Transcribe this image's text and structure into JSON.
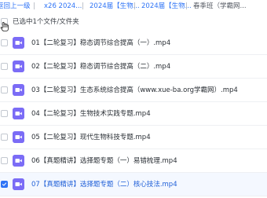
{
  "breadcrumb": {
    "back_label": "返回上一级",
    "separator": "|",
    "crumbs": [
      "x26 2024...",
      "2024届【生物...",
      "2024届【生物..."
    ],
    "current": "春季班（学霸网..."
  },
  "toolbar": {
    "selected_text": "已选中1个文件/文件夹"
  },
  "files": [
    {
      "name": "01【二轮复习】稳态调节综合提高（一）.mp4",
      "selected": false
    },
    {
      "name": "02【二轮复习】稳态调节综合提高（二）.mp4",
      "selected": false
    },
    {
      "name": "03【二轮复习】生态系统综合提高（www.xue-ba.org学霸网）.mp4",
      "selected": false
    },
    {
      "name": "04【二轮复习】生物技术实践专题.mp4",
      "selected": false
    },
    {
      "name": "05【二轮复习】现代生物科技专题.mp4",
      "selected": false
    },
    {
      "name": "06【真题精讲】选择题专题（一）易错梳理.mp4",
      "selected": false
    },
    {
      "name": "07【真题精讲】选择题专题（二）核心技法.mp4",
      "selected": true
    }
  ],
  "colors": {
    "accent": "#2f74f6",
    "video_icon": "#7b6cf6",
    "selected_bg": "#f4f8ff"
  },
  "icons": {
    "video_file": "video-file-icon",
    "cursor": "cursor-icon",
    "checkbox": "checkbox-icon"
  }
}
